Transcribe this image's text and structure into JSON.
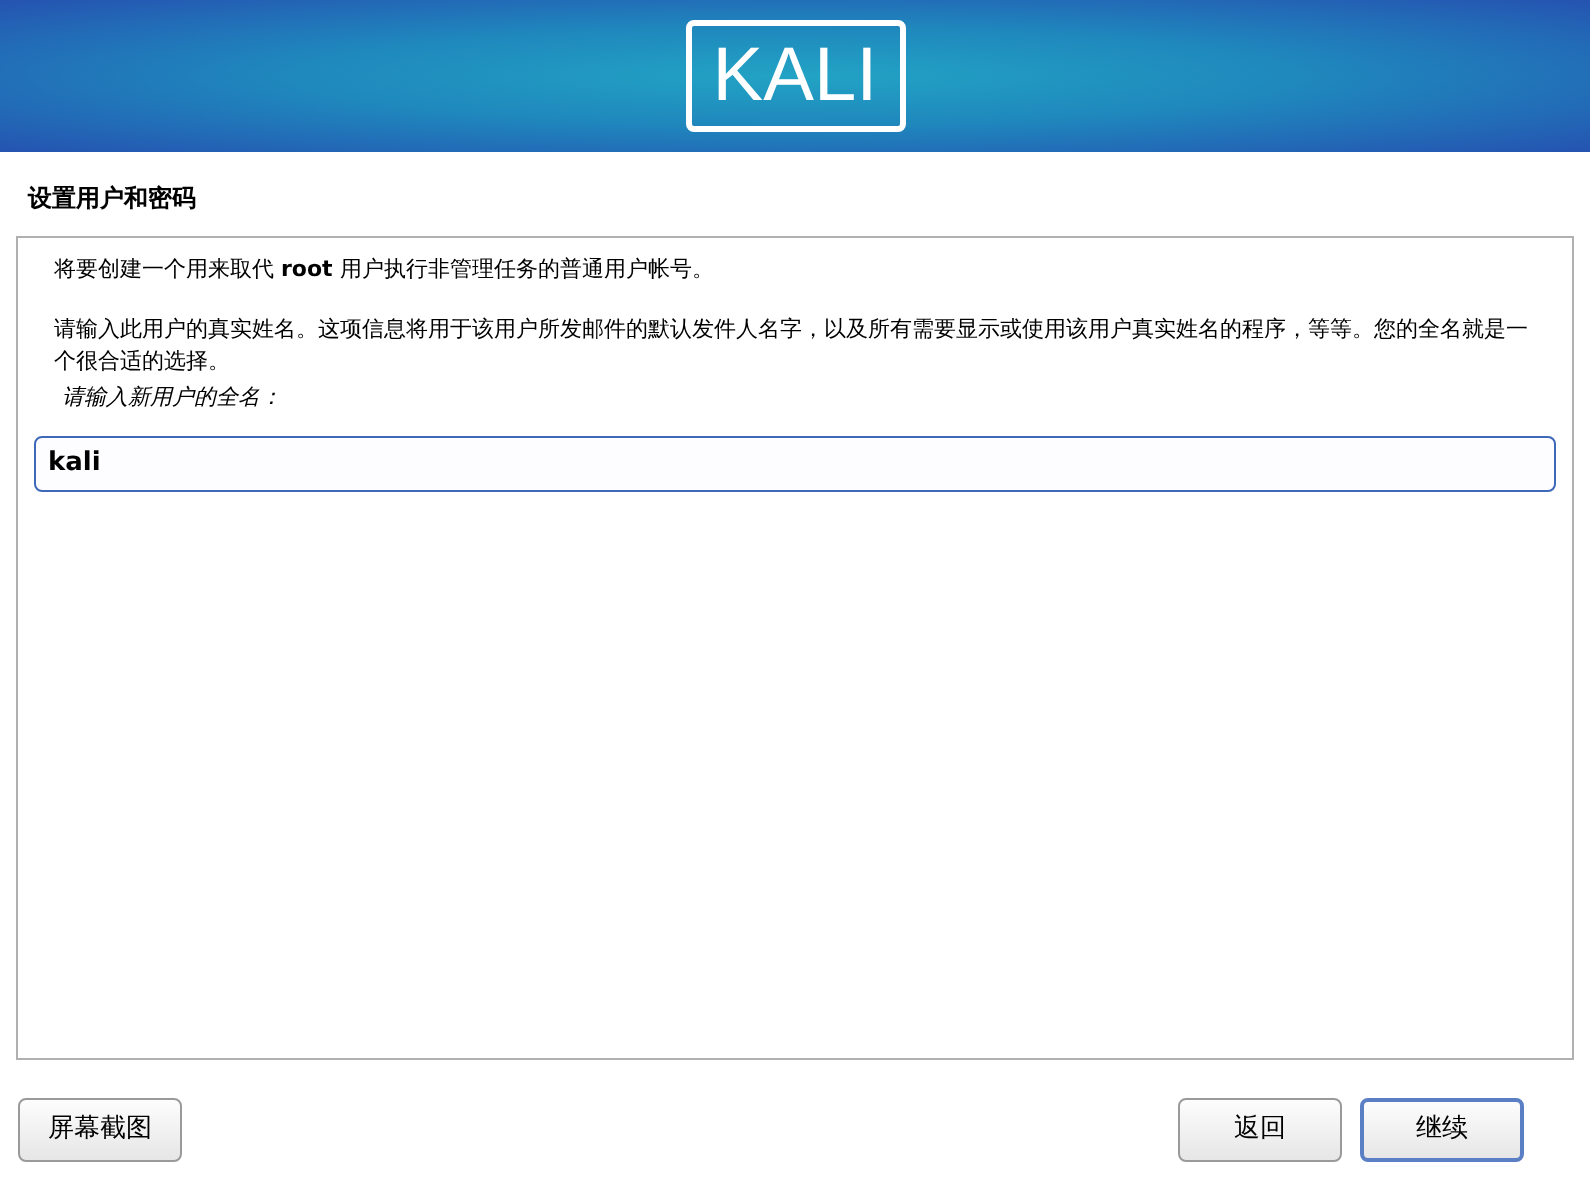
{
  "header": {
    "logo": "KALI"
  },
  "page_title": "设置用户和密码",
  "content": {
    "intro": "将要创建一个用来取代 **root** 用户执行非管理任务的普通用户帐号。",
    "description": "请输入此用户的真实姓名。这项信息将用于该用户所发邮件的默认发件人名字，以及所有需要显示或使用该用户真实姓名的程序，等等。您的全名就是一个很合适的选择。",
    "field_label": "请输入新用户的全名：",
    "field_value": "kali"
  },
  "buttons": [
    {
      "label": "屏幕截图",
      "selected": false
    },
    {
      "label": "返回",
      "selected": false
    },
    {
      "label": "继续",
      "selected": true
    }
  ]
}
